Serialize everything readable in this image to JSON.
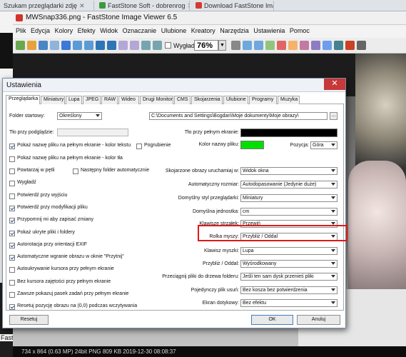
{
  "browser": {
    "tabs": [
      {
        "label": "Szukam przeglądarki zdję",
        "close": "✕"
      },
      {
        "label": "FastStone Soft - dobrenrog",
        "close": "✕"
      },
      {
        "label": "Download FastStone Imag",
        "close": ""
      }
    ],
    "left_label": "Fast"
  },
  "app": {
    "title": "MWSnap336.png  -  FastStone Image Viewer 6.5",
    "menu": [
      "Plik",
      "Edycja",
      "Kolory",
      "Efekty",
      "Widok",
      "Oznaczanie",
      "Ulubione",
      "Kreatory",
      "Narzędzia",
      "Ustawienia",
      "Pomoc"
    ],
    "toolbar": {
      "smooth_label": "Wygładź",
      "zoom_value": "76%"
    },
    "status": "734 x 864 (0.63 MP)   24bit  PNG    809 KB    2019-12-30 08:08:37"
  },
  "dialog": {
    "title": "Ustawienia",
    "close": "✕",
    "tabs": [
      "Przeglądarka",
      "Miniatury",
      "Lupa",
      "JPEG",
      "RAW",
      "Wideo",
      "Drugi Monitor",
      "CMS",
      "Skojarzenia",
      "Ulubione",
      "Programy",
      "Muzyka"
    ],
    "active_tab": "Przeglądarka",
    "left": {
      "start_folder_label": "Folder startowy:",
      "start_folder_value": "Określony",
      "bg_label": "Tło przy podglądzie:",
      "checkboxes": [
        {
          "label": "Pokaż nazwę pliku na pełnym ekranie - kolor tekstu",
          "checked": true
        },
        {
          "label": "Pokaż nazwę pliku na pełnym ekranie - kolor tła",
          "checked": false
        },
        {
          "label": "Powtarzaj w pętli",
          "checked": false
        },
        {
          "label": "Wygładź",
          "checked": false
        },
        {
          "label": "Potwierdź przy wyjściu",
          "checked": false
        },
        {
          "label": "Potwierdź przy modyfikacji pliku",
          "checked": true
        },
        {
          "label": "Przypomnij mi aby zapisać zmiany",
          "checked": true
        },
        {
          "label": "Pokaż ukryte pliki i foldery",
          "checked": true
        },
        {
          "label": "Autorotacja przy orientacji EXIF",
          "checked": true
        },
        {
          "label": "Automatyczne wgranie obrazu w oknie \"Przytnij\"",
          "checked": true
        },
        {
          "label": "Autoukrywanie kursora przy pełnym ekranie",
          "checked": false
        },
        {
          "label": "Bez kursora zajętości przy pełnym ekranie",
          "checked": false
        },
        {
          "label": "Zawsze pokazuj pasek zadań przy pełnym ekranie",
          "checked": false
        },
        {
          "label": "Resetuj pozycję obrazu na (0,0) podczas wczytywania",
          "checked": true
        }
      ],
      "extra_checkboxes": [
        {
          "label": "Pogrubienie",
          "checked": false
        },
        {
          "label": "Następny folder automatycznie",
          "checked": false
        }
      ]
    },
    "right": {
      "path_value": "C:\\Documents and Settings\\Bogdan\\Moje dokumenty\\Moje obrazy\\",
      "browse": "...",
      "fullscreen_bg_label": "Tło przy pełnym ekranie:",
      "filename_color_label": "Kolor nazwy pliku:",
      "position_label": "Pozycja:",
      "position_value": "Góra",
      "rows": [
        {
          "label": "Skojarzone obrazy uruchamiaj w:",
          "value": "Widok okna"
        },
        {
          "label": "Automatyczny rozmiar:",
          "value": "Autodopasowanie (Jedynie duże)"
        },
        {
          "label": "Domyślny styl przeglądarki:",
          "value": "Miniatury"
        },
        {
          "label": "Domyślna jednostka:",
          "value": "cm"
        },
        {
          "label": "Klawisze strzałek:",
          "value": "Przewiń"
        },
        {
          "label": "Rolka myszy:",
          "value": "Przybliż / Oddal"
        },
        {
          "label": "Klawisz myszki:",
          "value": "Lupa"
        },
        {
          "label": "Przybliż / Oddal:",
          "value": "Wyśrodkowany"
        },
        {
          "label": "Przeciągnij pliki do drzewa folderu:",
          "value": "Jeśli ten sam dysk przenieś pliki"
        },
        {
          "label": "Pojedynczy plik usuń:",
          "value": "Bez kosza bez potwierdzenia"
        },
        {
          "label": "Ekran dotykowy:",
          "value": "Bez efektu"
        }
      ]
    },
    "buttons": {
      "reset": "Resetuj",
      "ok": "OK",
      "cancel": "Anuluj"
    },
    "colors": {
      "filename_color": "#00e000",
      "fullscreen_bg": "#000000",
      "highlight": "#e01919"
    }
  }
}
